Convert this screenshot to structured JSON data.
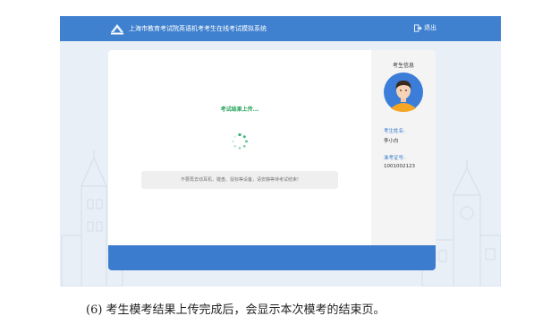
{
  "app": {
    "title": "上海市教育考试院英语机考考生在线考试模拟系统",
    "logout_label": "退出",
    "accent_color": "#3f80cf"
  },
  "main": {
    "status_text": "考试结果上传...",
    "notice": "不要再去动耳机、键盘、鼠标等设备，请安静等待考试结束!"
  },
  "sidebar": {
    "title": "考生信息",
    "name_label": "考生姓名:",
    "name_value": "李小白",
    "id_label": "准考证号:",
    "id_value": "1001002123",
    "avatar_icon": "student-avatar-icon"
  },
  "caption": "(6)   考生模考结果上传完成后，会显示本次模考的结束页。"
}
